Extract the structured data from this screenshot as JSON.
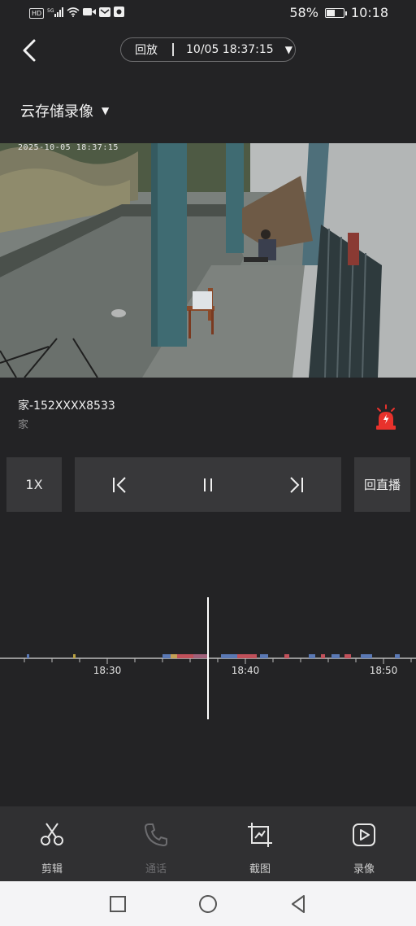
{
  "status_bar": {
    "hd": "HD",
    "signal": "5G",
    "battery": "58%",
    "battery_level": 0.58,
    "time": "10:18",
    "icons": [
      "hd-icon",
      "5g-signal-icon",
      "wifi-icon",
      "camera-icon",
      "mail-icon",
      "app-icon"
    ]
  },
  "header": {
    "mode": "回放",
    "datetime": "10/05 18:37:15"
  },
  "storage_selector": "云存储录像",
  "video": {
    "timestamp": "2025-10-05 18:37:15"
  },
  "device": {
    "name": "家-152XXXX8533",
    "group": "家"
  },
  "controls": {
    "speed": "1X",
    "live": "回直播"
  },
  "timeline": {
    "labels": [
      "18:30",
      "18:40",
      "18:50"
    ],
    "cursor_time": "18:37:15"
  },
  "toolbar": {
    "items": [
      {
        "label": "剪辑",
        "icon": "scissors-icon",
        "enabled": true
      },
      {
        "label": "通话",
        "icon": "phone-icon",
        "enabled": false
      },
      {
        "label": "截图",
        "icon": "screenshot-icon",
        "enabled": true
      },
      {
        "label": "录像",
        "icon": "record-video-icon",
        "enabled": true
      }
    ]
  },
  "colors": {
    "background": "#232325",
    "alarm": "#e8322c",
    "event_red": "#c0505a",
    "event_blue": "#5a78b4"
  }
}
